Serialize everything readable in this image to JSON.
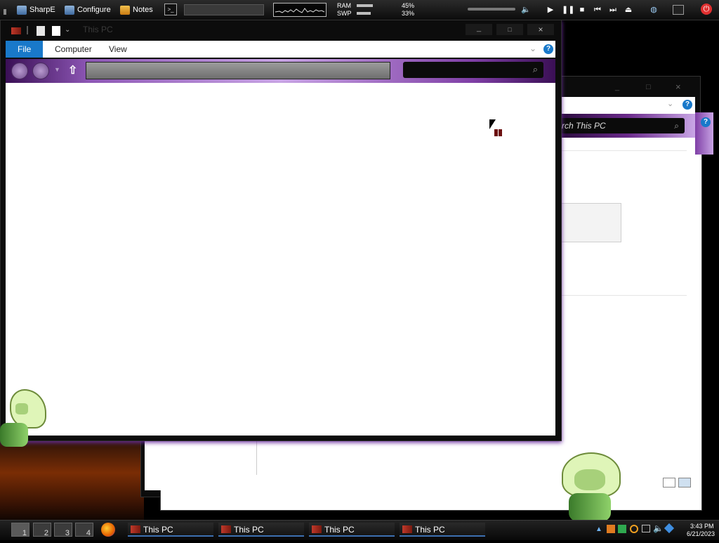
{
  "topbar": {
    "sharpe_label": "SharpE",
    "configure_label": "Configure",
    "notes_label": "Notes",
    "ram_label": "RAM",
    "swp_label": "SWP",
    "ram_value": "45%",
    "swp_value": "33%",
    "icons": [
      "sharpe-icon",
      "configure-icon",
      "notes-icon",
      "terminal-icon",
      "volume-icon",
      "play-icon",
      "pause-icon",
      "stop-icon",
      "previous-icon",
      "next-icon",
      "eject-icon",
      "network-icon",
      "monitor-icon",
      "power-icon"
    ]
  },
  "main_window": {
    "title": "This PC",
    "ribbon_tabs": [
      "File",
      "Computer",
      "View"
    ]
  },
  "back_window": {
    "search_placeholder": "rch This PC"
  },
  "taskbar": {
    "desktops": [
      "1",
      "2",
      "3",
      "4"
    ],
    "tasks": [
      "This PC",
      "This PC",
      "This PC",
      "This PC"
    ],
    "clock_time": "3:43 PM",
    "clock_date": "6/21/2023"
  },
  "colors": {
    "accent_purple": "#8c56b4",
    "file_tab_blue": "#1979ca",
    "power_red": "#e03030"
  }
}
